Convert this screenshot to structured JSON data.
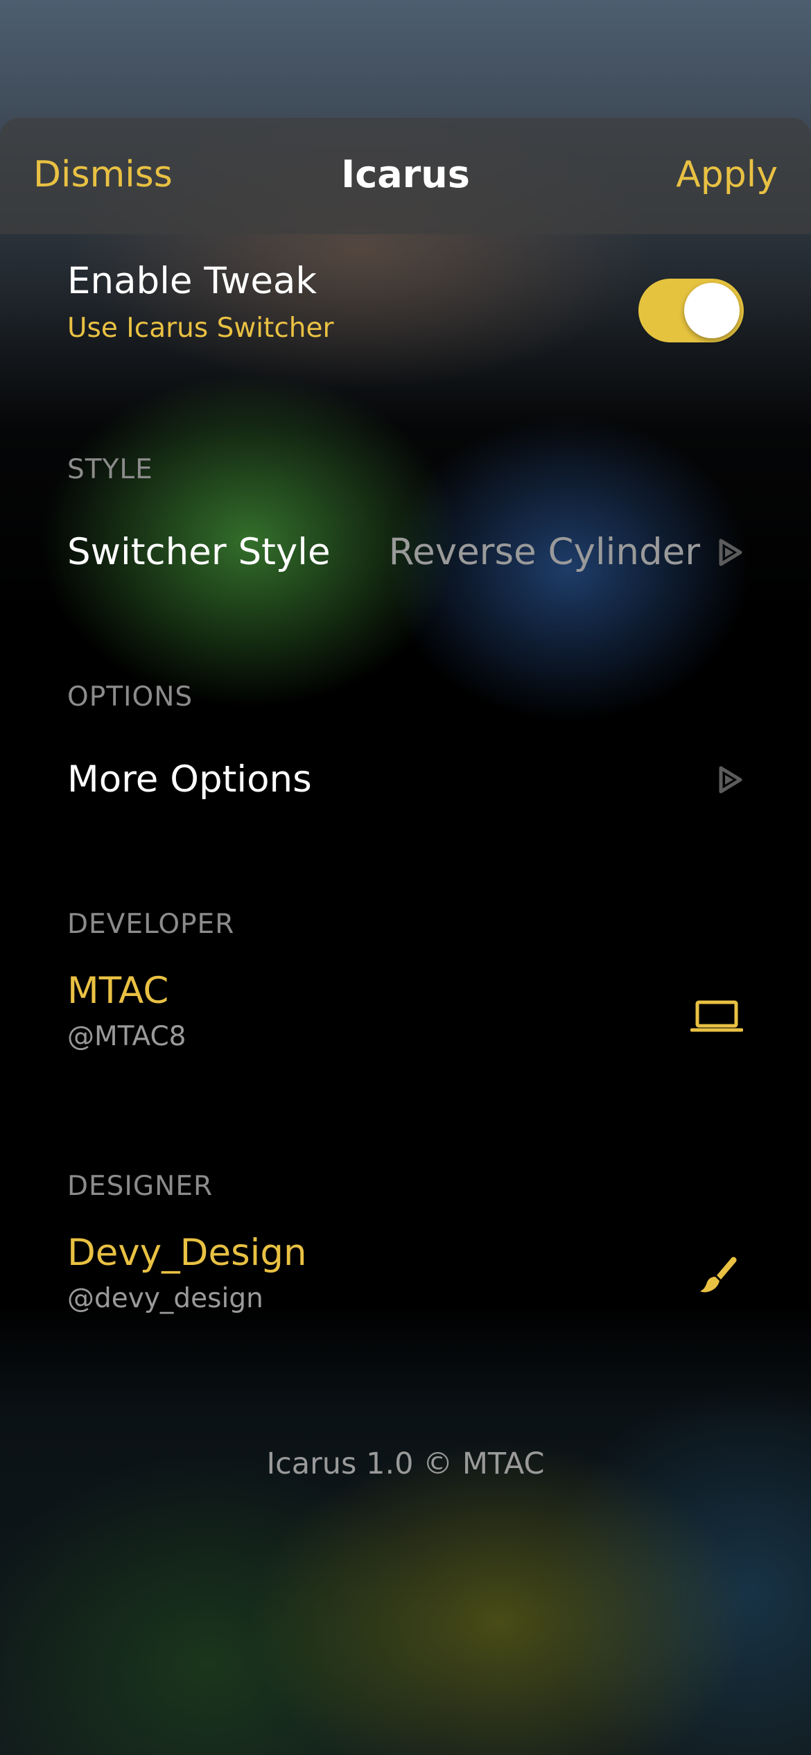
{
  "nav": {
    "dismiss_label": "Dismiss",
    "title": "Icarus",
    "apply_label": "Apply"
  },
  "enable_tweak": {
    "title": "Enable Tweak",
    "subtitle": "Use Icarus Switcher",
    "toggle_on": true
  },
  "sections": {
    "style": {
      "header": "STYLE",
      "switcher_style": {
        "label": "Switcher Style",
        "value": "Reverse Cylinder",
        "icon": "chevron-right-icon"
      }
    },
    "options": {
      "header": "OPTIONS",
      "more_options": {
        "label": "More Options",
        "icon": "chevron-right-icon"
      }
    },
    "developer": {
      "header": "DEVELOPER",
      "name": "MTAC",
      "handle": "@MTAC8",
      "icon": "laptop-icon"
    },
    "designer": {
      "header": "DESIGNER",
      "name": "Devy_Design",
      "handle": "@devy_design",
      "icon": "paintbrush-icon"
    }
  },
  "footer": {
    "text": "Icarus 1.0 © MTAC"
  },
  "colors": {
    "accent": "#e9c143",
    "text_primary": "#ffffff",
    "text_secondary": "#9a9a9a"
  }
}
